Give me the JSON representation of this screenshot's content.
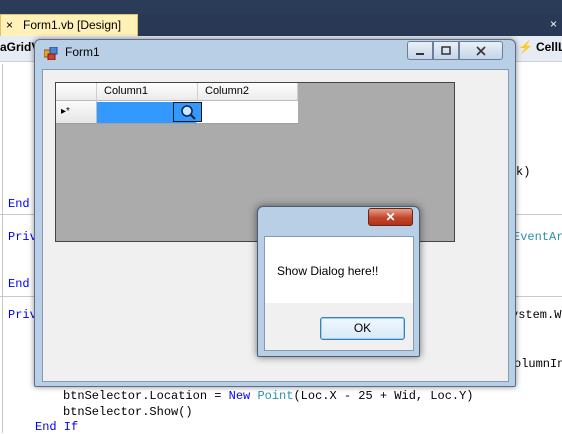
{
  "ide": {
    "tab_close": "×",
    "active_tab": "Form1.vb [Design]",
    "tab_right_close": "×",
    "left_combo": "aGridVi",
    "right_combo": "CellL"
  },
  "code": {
    "end1": "End",
    "priv1": "Priv",
    "end2": "End",
    "priv2": "Priv",
    "right1": "k)",
    "right2": "EventArg",
    "right3": "ystem.Wi",
    "right4": "olumnInd",
    "line1_a": "btnSelector.Location = ",
    "line1_new": "New",
    "line1_sp": " ",
    "line1_type": "Point",
    "line1_b": "(Loc.X - 25 + Wid, Loc.Y)",
    "line2": "btnSelector.Show()",
    "line3_kw": "End If"
  },
  "form": {
    "title": "Form1",
    "grid": {
      "columns": [
        "Column1",
        "Column2"
      ],
      "row_marker": "▸*"
    }
  },
  "dialog": {
    "close": "✕",
    "message": "Show Dialog here!!",
    "ok": "OK"
  },
  "colors": {
    "selection": "#3399ff",
    "grid_background": "#ababab",
    "keyword": "#0000ff",
    "type": "#2b91af"
  }
}
